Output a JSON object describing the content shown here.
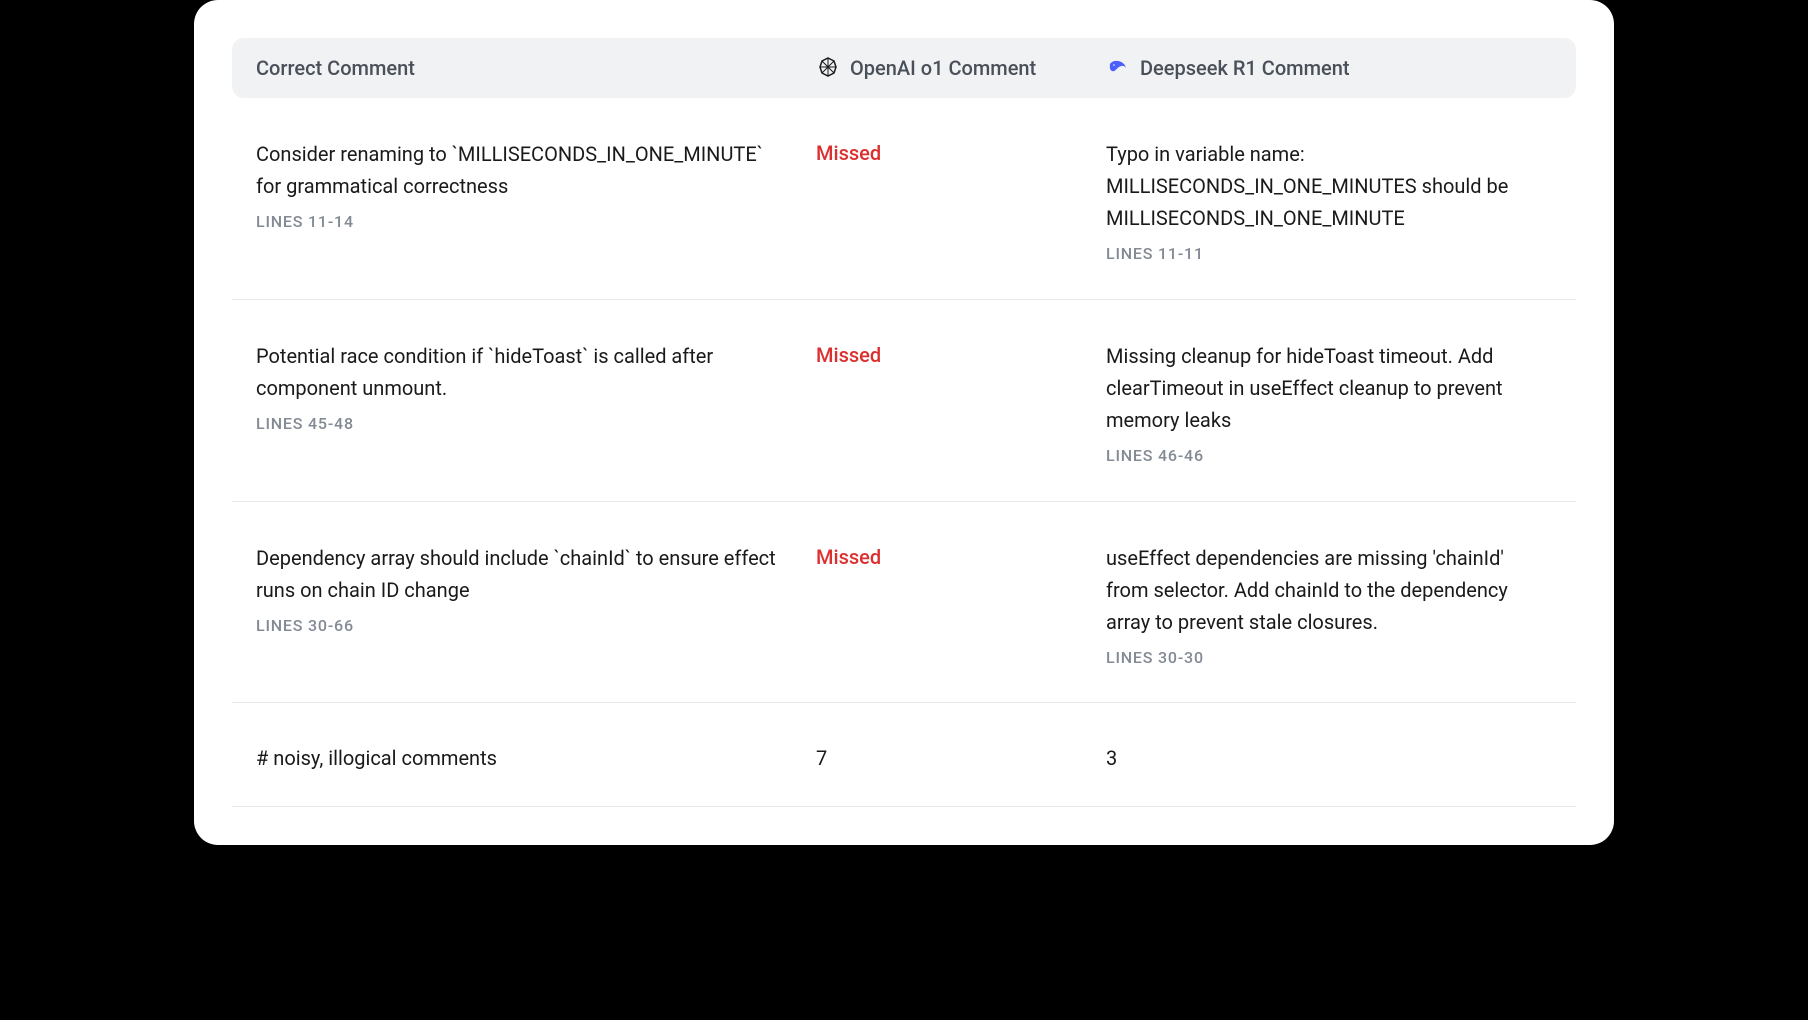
{
  "headers": {
    "correct": "Correct Comment",
    "openai": "OpenAI o1 Comment",
    "deepseek": "Deepseek R1 Comment"
  },
  "rows": [
    {
      "correct": {
        "text": "Consider renaming to `MILLISECONDS_IN_ONE_MINUTE` for grammatical correctness",
        "lines": "LINES 11-14"
      },
      "openai": {
        "status": "Missed"
      },
      "deepseek": {
        "text": "Typo in variable name: MILLISECONDS_IN_ONE_MINUTES should be MILLISECONDS_IN_ONE_MINUTE",
        "lines": "LINES 11-11"
      }
    },
    {
      "correct": {
        "text": "Potential race condition if `hideToast` is called after component unmount.",
        "lines": "LINES 45-48"
      },
      "openai": {
        "status": "Missed"
      },
      "deepseek": {
        "text": " Missing cleanup for hideToast timeout. Add clearTimeout in useEffect cleanup to prevent memory leaks",
        "lines": "LINES 46-46"
      }
    },
    {
      "correct": {
        "text": "Dependency array should include `chainId` to ensure effect runs on chain ID change",
        "lines": "LINES 30-66"
      },
      "openai": {
        "status": "Missed"
      },
      "deepseek": {
        "text": "useEffect dependencies are missing 'chainId' from selector. Add chainId to the dependency array to prevent stale closures.",
        "lines": "LINES 30-30"
      }
    }
  ],
  "summary": {
    "label": "# noisy, illogical comments",
    "openai_count": "7",
    "deepseek_count": "3"
  }
}
